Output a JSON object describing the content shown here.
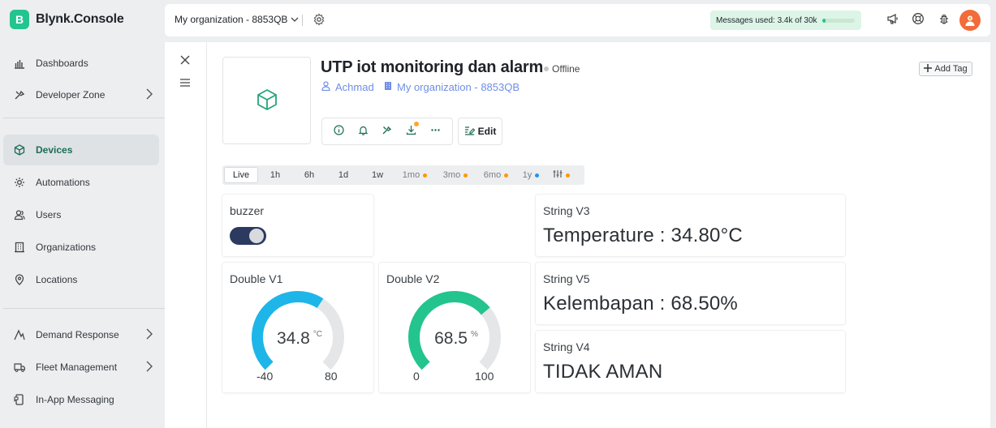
{
  "app": {
    "logo_letter": "B",
    "name": "Blynk.Console"
  },
  "sidebar": {
    "items": [
      {
        "label": "Dashboards",
        "icon": "dashboards-icon"
      },
      {
        "label": "Developer Zone",
        "icon": "developer-zone-icon",
        "has_children": true
      },
      {
        "label": "Devices",
        "icon": "cube-icon",
        "active": true
      },
      {
        "label": "Automations",
        "icon": "automations-icon"
      },
      {
        "label": "Users",
        "icon": "users-icon"
      },
      {
        "label": "Organizations",
        "icon": "organizations-icon"
      },
      {
        "label": "Locations",
        "icon": "location-pin-icon"
      },
      {
        "label": "Demand Response",
        "icon": "demand-response-icon",
        "has_children": true
      },
      {
        "label": "Fleet Management",
        "icon": "truck-icon",
        "has_children": true
      },
      {
        "label": "In-App Messaging",
        "icon": "messaging-icon"
      }
    ]
  },
  "topbar": {
    "org_selector": "My organization - 8853QB",
    "messages_used": "Messages used: 3.4k of 30k",
    "messages_used_fraction": 0.113
  },
  "device": {
    "name": "UTP iot monitoring dan alarm",
    "status": "Offline",
    "owner": "Achmad",
    "organization": "My organization - 8853QB",
    "add_tag": "Add Tag",
    "edit": "Edit"
  },
  "time_ranges": [
    {
      "label": "Live",
      "active": true
    },
    {
      "label": "1h"
    },
    {
      "label": "6h"
    },
    {
      "label": "1d"
    },
    {
      "label": "1w"
    },
    {
      "label": "1mo",
      "dot": "#ff9800",
      "muted": true
    },
    {
      "label": "3mo",
      "dot": "#ff9800",
      "muted": true
    },
    {
      "label": "6mo",
      "dot": "#ff9800",
      "muted": true
    },
    {
      "label": "1y",
      "dot": "#2196f3",
      "muted": true
    }
  ],
  "widgets": {
    "buzzer": {
      "title": "buzzer",
      "on": true
    },
    "v1": {
      "title": "Double V1",
      "value": "34.8",
      "unit": "°C",
      "min": "-40",
      "max": "80",
      "value_num": 34.8,
      "min_num": -40,
      "max_num": 80,
      "color": "#1eb6e8"
    },
    "v2": {
      "title": "Double V2",
      "value": "68.5",
      "unit": "%",
      "min": "0",
      "max": "100",
      "value_num": 68.5,
      "min_num": 0,
      "max_num": 100,
      "color": "#23c48e"
    },
    "v3": {
      "title": "String V3",
      "text": "Temperature : 34.80°C"
    },
    "v5": {
      "title": "String V5",
      "text": "Kelembapan : 68.50%"
    },
    "v4": {
      "title": "String V4",
      "text": "TIDAK AMAN"
    }
  },
  "colors": {
    "brand": "#23c48e",
    "link": "#6f8ee6",
    "toggle_on": "#2b3a5e",
    "gauge_track": "#e4e6e8"
  }
}
